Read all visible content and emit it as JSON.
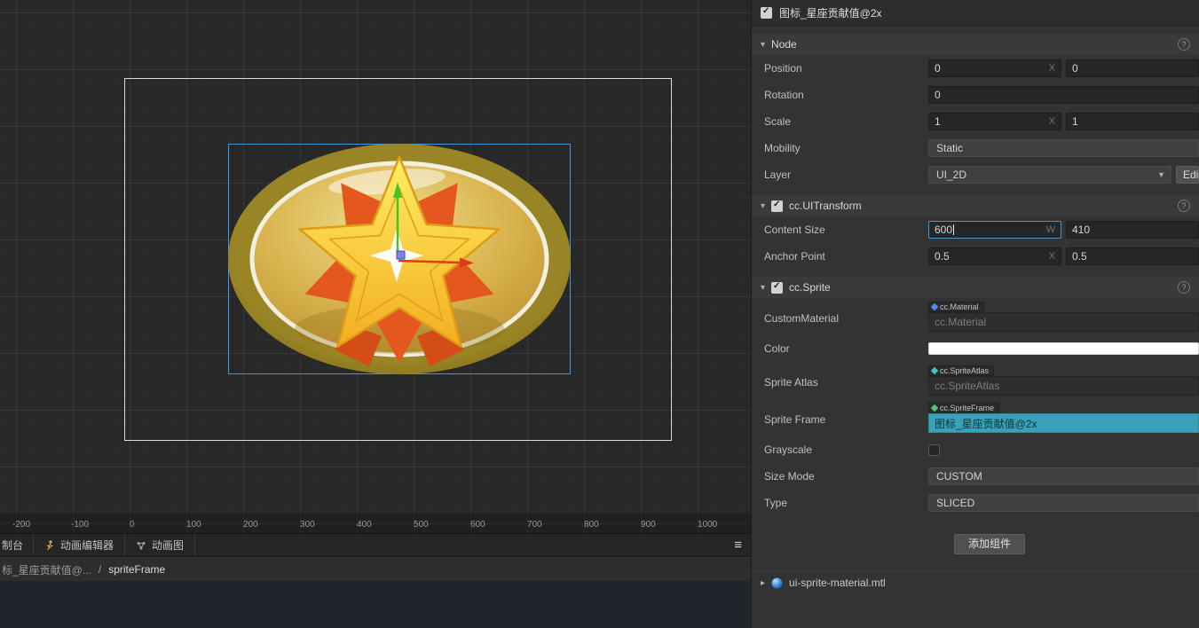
{
  "colors": {
    "selection_box": "#3f97e8",
    "axis_x_arrow": "#de3a17",
    "axis_y_arrow": "#44c421",
    "origin_handle": "#8080ea",
    "sprite_frame_selected_bg": "#38a0b8",
    "material_diamond": "#5a8ee6",
    "atlas_diamond": "#43bfd0",
    "frame_diamond": "#4ec96e",
    "color_value": "#FFFFFF"
  },
  "icons": {
    "chevron_down": "▾",
    "chevron_right": "▸",
    "help": "?",
    "menu": "≡"
  },
  "scene": {
    "ruler_ticks": [
      "-200",
      "-100",
      "0",
      "100",
      "200",
      "300",
      "400",
      "500",
      "600",
      "700",
      "800",
      "900",
      "1000"
    ]
  },
  "tabbar": {
    "tab_console": "制台",
    "tab_anim_editor": "动画编辑器",
    "tab_anim_graph": "动画图"
  },
  "breadcrumb": {
    "path": "标_星座贡献值@...",
    "separator": "/",
    "current": "spriteFrame"
  },
  "inspector": {
    "title": "图标_星座贡献值@2x",
    "node": {
      "title": "Node",
      "position": {
        "label": "Position",
        "x": "0",
        "y": "0",
        "x_suffix": "X"
      },
      "rotation": {
        "label": "Rotation",
        "value": "0"
      },
      "scale": {
        "label": "Scale",
        "x": "1",
        "y": "1",
        "x_suffix": "X"
      },
      "mobility": {
        "label": "Mobility",
        "value": "Static"
      },
      "layer": {
        "label": "Layer",
        "value": "UI_2D",
        "edit_button": "Edit"
      }
    },
    "uitransform": {
      "title": "cc.UITransform",
      "content_size": {
        "label": "Content Size",
        "w": "600",
        "h": "410",
        "w_suffix": "W"
      },
      "anchor_point": {
        "label": "Anchor Point",
        "x": "0.5",
        "y": "0.5",
        "x_suffix": "X"
      }
    },
    "sprite": {
      "title": "cc.Sprite",
      "custom_material": {
        "label": "CustomMaterial",
        "badge": "cc.Material",
        "value": "cc.Material"
      },
      "color": {
        "label": "Color"
      },
      "sprite_atlas": {
        "label": "Sprite Atlas",
        "badge": "cc.SpriteAtlas",
        "value": "cc.SpriteAtlas"
      },
      "sprite_frame": {
        "label": "Sprite Frame",
        "badge": "cc.SpriteFrame",
        "value": "图标_星座贡献值@2x"
      },
      "grayscale": {
        "label": "Grayscale"
      },
      "size_mode": {
        "label": "Size Mode",
        "value": "CUSTOM"
      },
      "type": {
        "label": "Type",
        "value": "SLICED"
      }
    },
    "add_component": "添加组件",
    "footer_asset": "ui-sprite-material.mtl"
  }
}
